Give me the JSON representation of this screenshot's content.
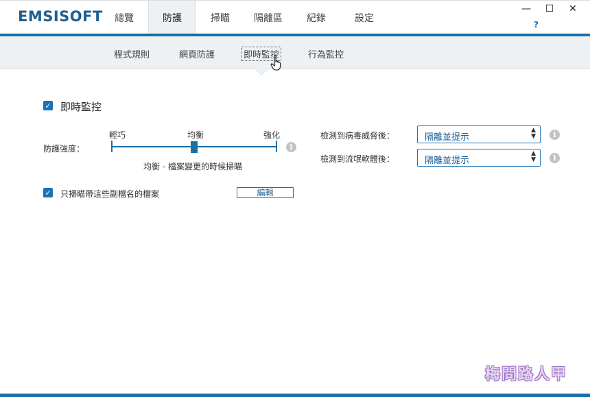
{
  "app": {
    "logo": "EMSISOFT"
  },
  "tabs": [
    "總覽",
    "防護",
    "掃瞄",
    "隔離區",
    "紀錄",
    "設定"
  ],
  "window_controls": {
    "minimize": "—",
    "maximize": "☐",
    "close": "✕",
    "help": "?"
  },
  "subtabs": [
    "程式規則",
    "網頁防護",
    "即時監控",
    "行為監控"
  ],
  "realtime": {
    "enabled_label": "即時監控",
    "strength_label": "防護強度：",
    "levels": {
      "low": "輕巧",
      "mid": "均衡",
      "high": "強化"
    },
    "slider_level": 0.5,
    "slider_desc": "均衡 - 檔案變更的時候掃瞄",
    "ext_only_label": "只掃瞄帶這些副檔名的檔案",
    "edit_button": "編輯"
  },
  "actions": {
    "virus_label": "檢測到病毒威脅後：",
    "virus_value": "隔離並提示",
    "pup_label": "檢測到流氓軟體後：",
    "pup_value": "隔離並提示"
  },
  "icons": {
    "checkbox": "check-icon",
    "info": "info-icon",
    "cursor": "hand-cursor-icon",
    "select": "updown-arrow-icon"
  },
  "watermark": "梅問路人甲",
  "colors": {
    "accent": "#1a6fa8",
    "logo": "#1f5e8f",
    "subbar": "#eef1f4"
  }
}
